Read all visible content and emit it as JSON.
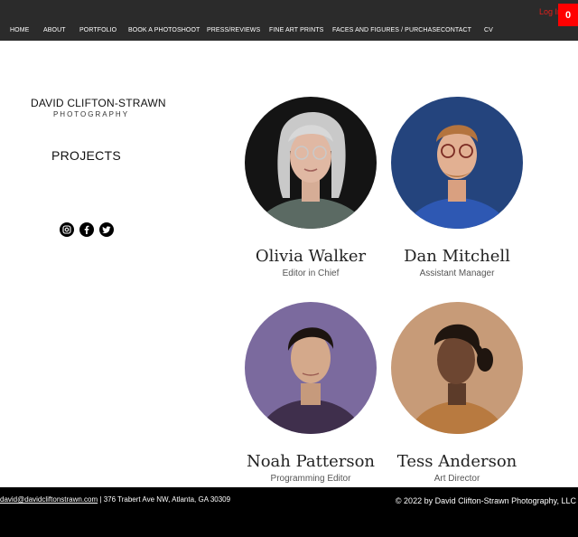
{
  "header": {
    "login_label": "Log In",
    "cart_count": "0",
    "nav": [
      "HOME",
      "ABOUT",
      "PORTFOLIO",
      "BOOK A PHOTOSHOOT",
      "PRESS/REVIEWS",
      "FINE ART PRINTS",
      "FACES AND FIGURES / PURCHASE",
      "CONTACT",
      "CV"
    ]
  },
  "sidebar": {
    "brand_name": "DAVID CLIFTON-STRAWN",
    "brand_sub": "PHOTOGRAPHY",
    "section_title": "PROJECTS",
    "social_icons": [
      "instagram-icon",
      "facebook-icon",
      "twitter-icon"
    ]
  },
  "team": [
    {
      "name": "Olivia Walker",
      "role": "Editor in Chief"
    },
    {
      "name": "Dan Mitchell",
      "role": "Assistant Manager"
    },
    {
      "name": "Noah Patterson",
      "role": "Programming Editor"
    },
    {
      "name": "Tess Anderson",
      "role": "Art Director"
    }
  ],
  "footer": {
    "email": "david@davidcliftonstrawn.com",
    "address": " | 376 Trabert Ave NW, Atlanta, GA 30309",
    "copyright": "© 2022 by David Clifton-Strawn Photography, LLC"
  },
  "colors": {
    "header_bg": "#2b2b2b",
    "accent_red": "#ff0000",
    "footer_bg": "#000000"
  }
}
